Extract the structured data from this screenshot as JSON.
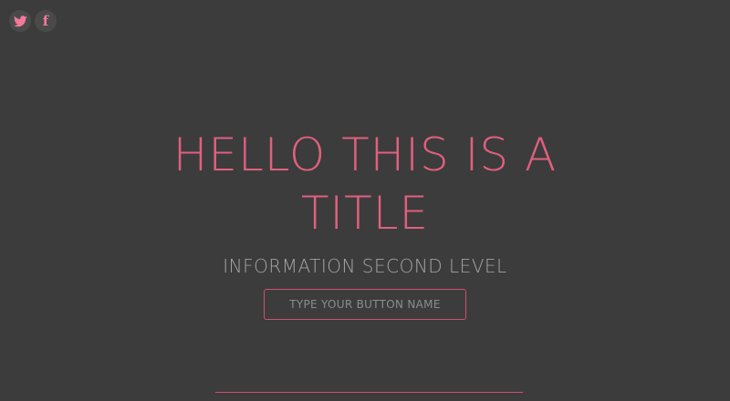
{
  "social": {
    "items": [
      {
        "icon": "twitter-icon"
      },
      {
        "icon": "facebook-icon",
        "glyph": "f"
      }
    ]
  },
  "hero": {
    "title": "HELLO THIS IS A TITLE",
    "subtitle": "INFORMATION SECOND LEVEL",
    "button_label": "TYPE YOUR BUTTON NAME"
  },
  "colors": {
    "background": "#3c3c3c",
    "accent": "#e0607f",
    "muted_text": "#a4a4a4"
  }
}
